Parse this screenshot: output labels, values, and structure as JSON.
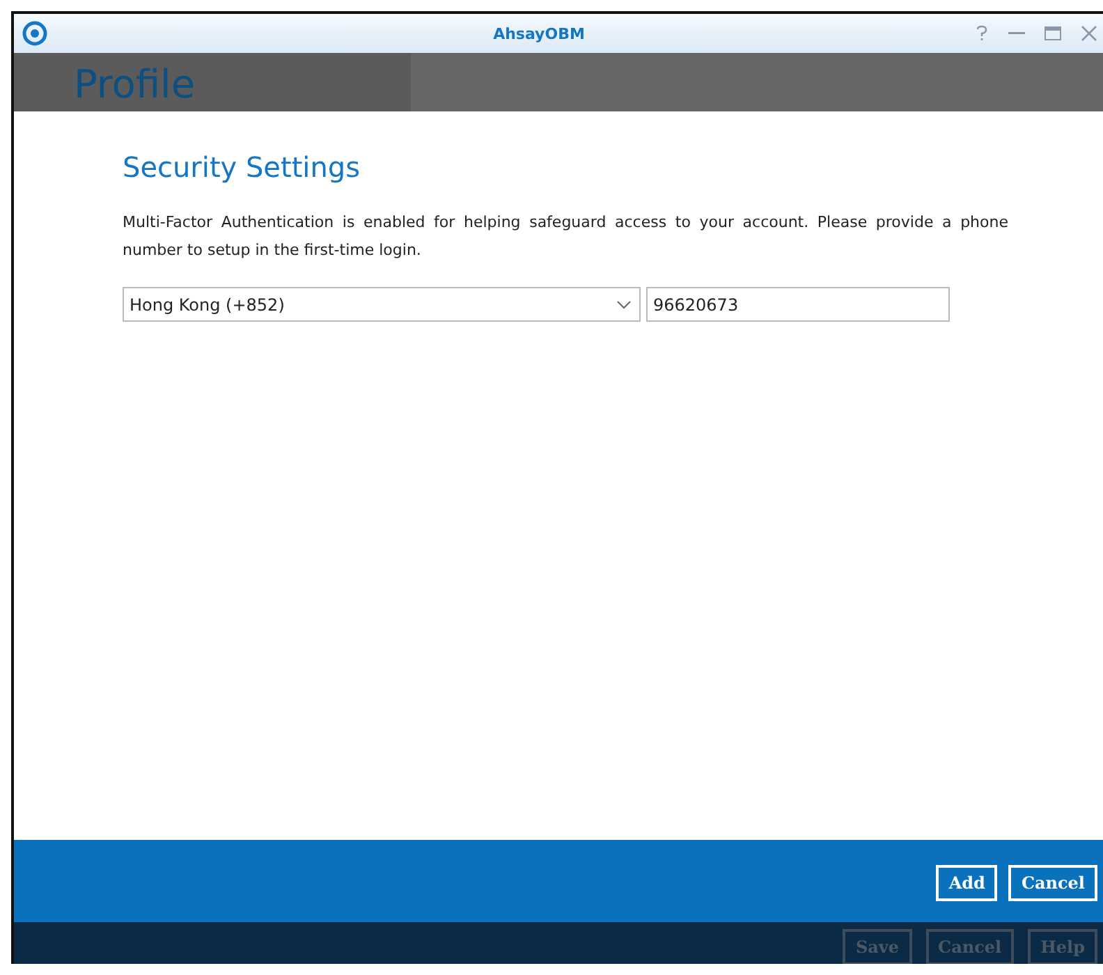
{
  "window": {
    "title": "AhsayOBM"
  },
  "header": {
    "title": "Profile"
  },
  "section": {
    "title": "Security Settings",
    "description": "Multi-Factor Authentication is enabled for helping safeguard access to your account. Please provide a phone number to setup in the first-time login.",
    "country": "Hong Kong (+852)",
    "phone": "96620673"
  },
  "dialog_buttons": [
    {
      "label": "Add",
      "disabled": false
    },
    {
      "label": "Cancel",
      "disabled": false
    }
  ],
  "footer_buttons": [
    {
      "label": "Save",
      "disabled": true
    },
    {
      "label": "Cancel",
      "disabled": true
    },
    {
      "label": "Help",
      "disabled": true
    }
  ]
}
